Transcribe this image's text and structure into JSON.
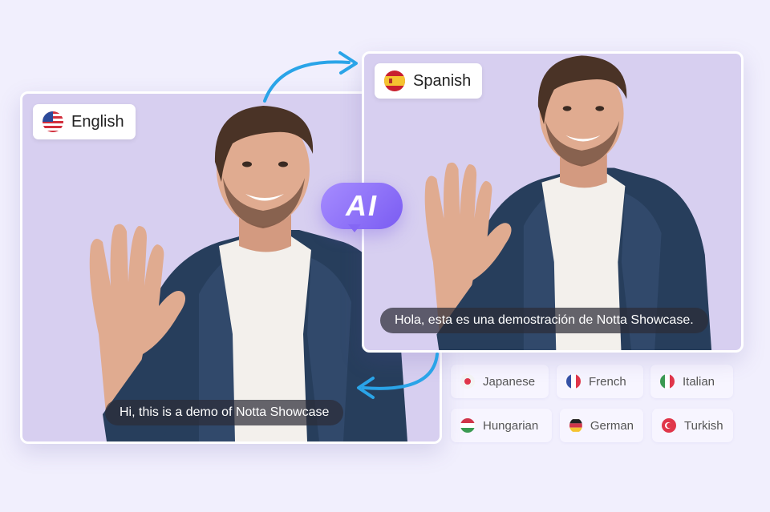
{
  "source_card": {
    "language": "English",
    "flag_icon": "us-flag-icon",
    "subtitle": "Hi, this is a demo of Notta Showcase"
  },
  "target_card": {
    "language": "Spanish",
    "flag_icon": "spain-flag-icon",
    "subtitle": "Hola, esta es una demostración de Notta Showcase."
  },
  "ai_badge": {
    "label": "AI"
  },
  "languages": [
    {
      "label": "Japanese",
      "icon": "japan-flag-icon"
    },
    {
      "label": "French",
      "icon": "france-flag-icon"
    },
    {
      "label": "Italian",
      "icon": "italy-flag-icon"
    },
    {
      "label": "Hungarian",
      "icon": "hungary-flag-icon"
    },
    {
      "label": "German",
      "icon": "germany-flag-icon"
    },
    {
      "label": "Turkish",
      "icon": "turkey-flag-icon"
    }
  ],
  "colors": {
    "background": "#f1effd",
    "card": "#d7cff0",
    "accent": "#8567f4",
    "arrow": "#2aa4e8"
  }
}
